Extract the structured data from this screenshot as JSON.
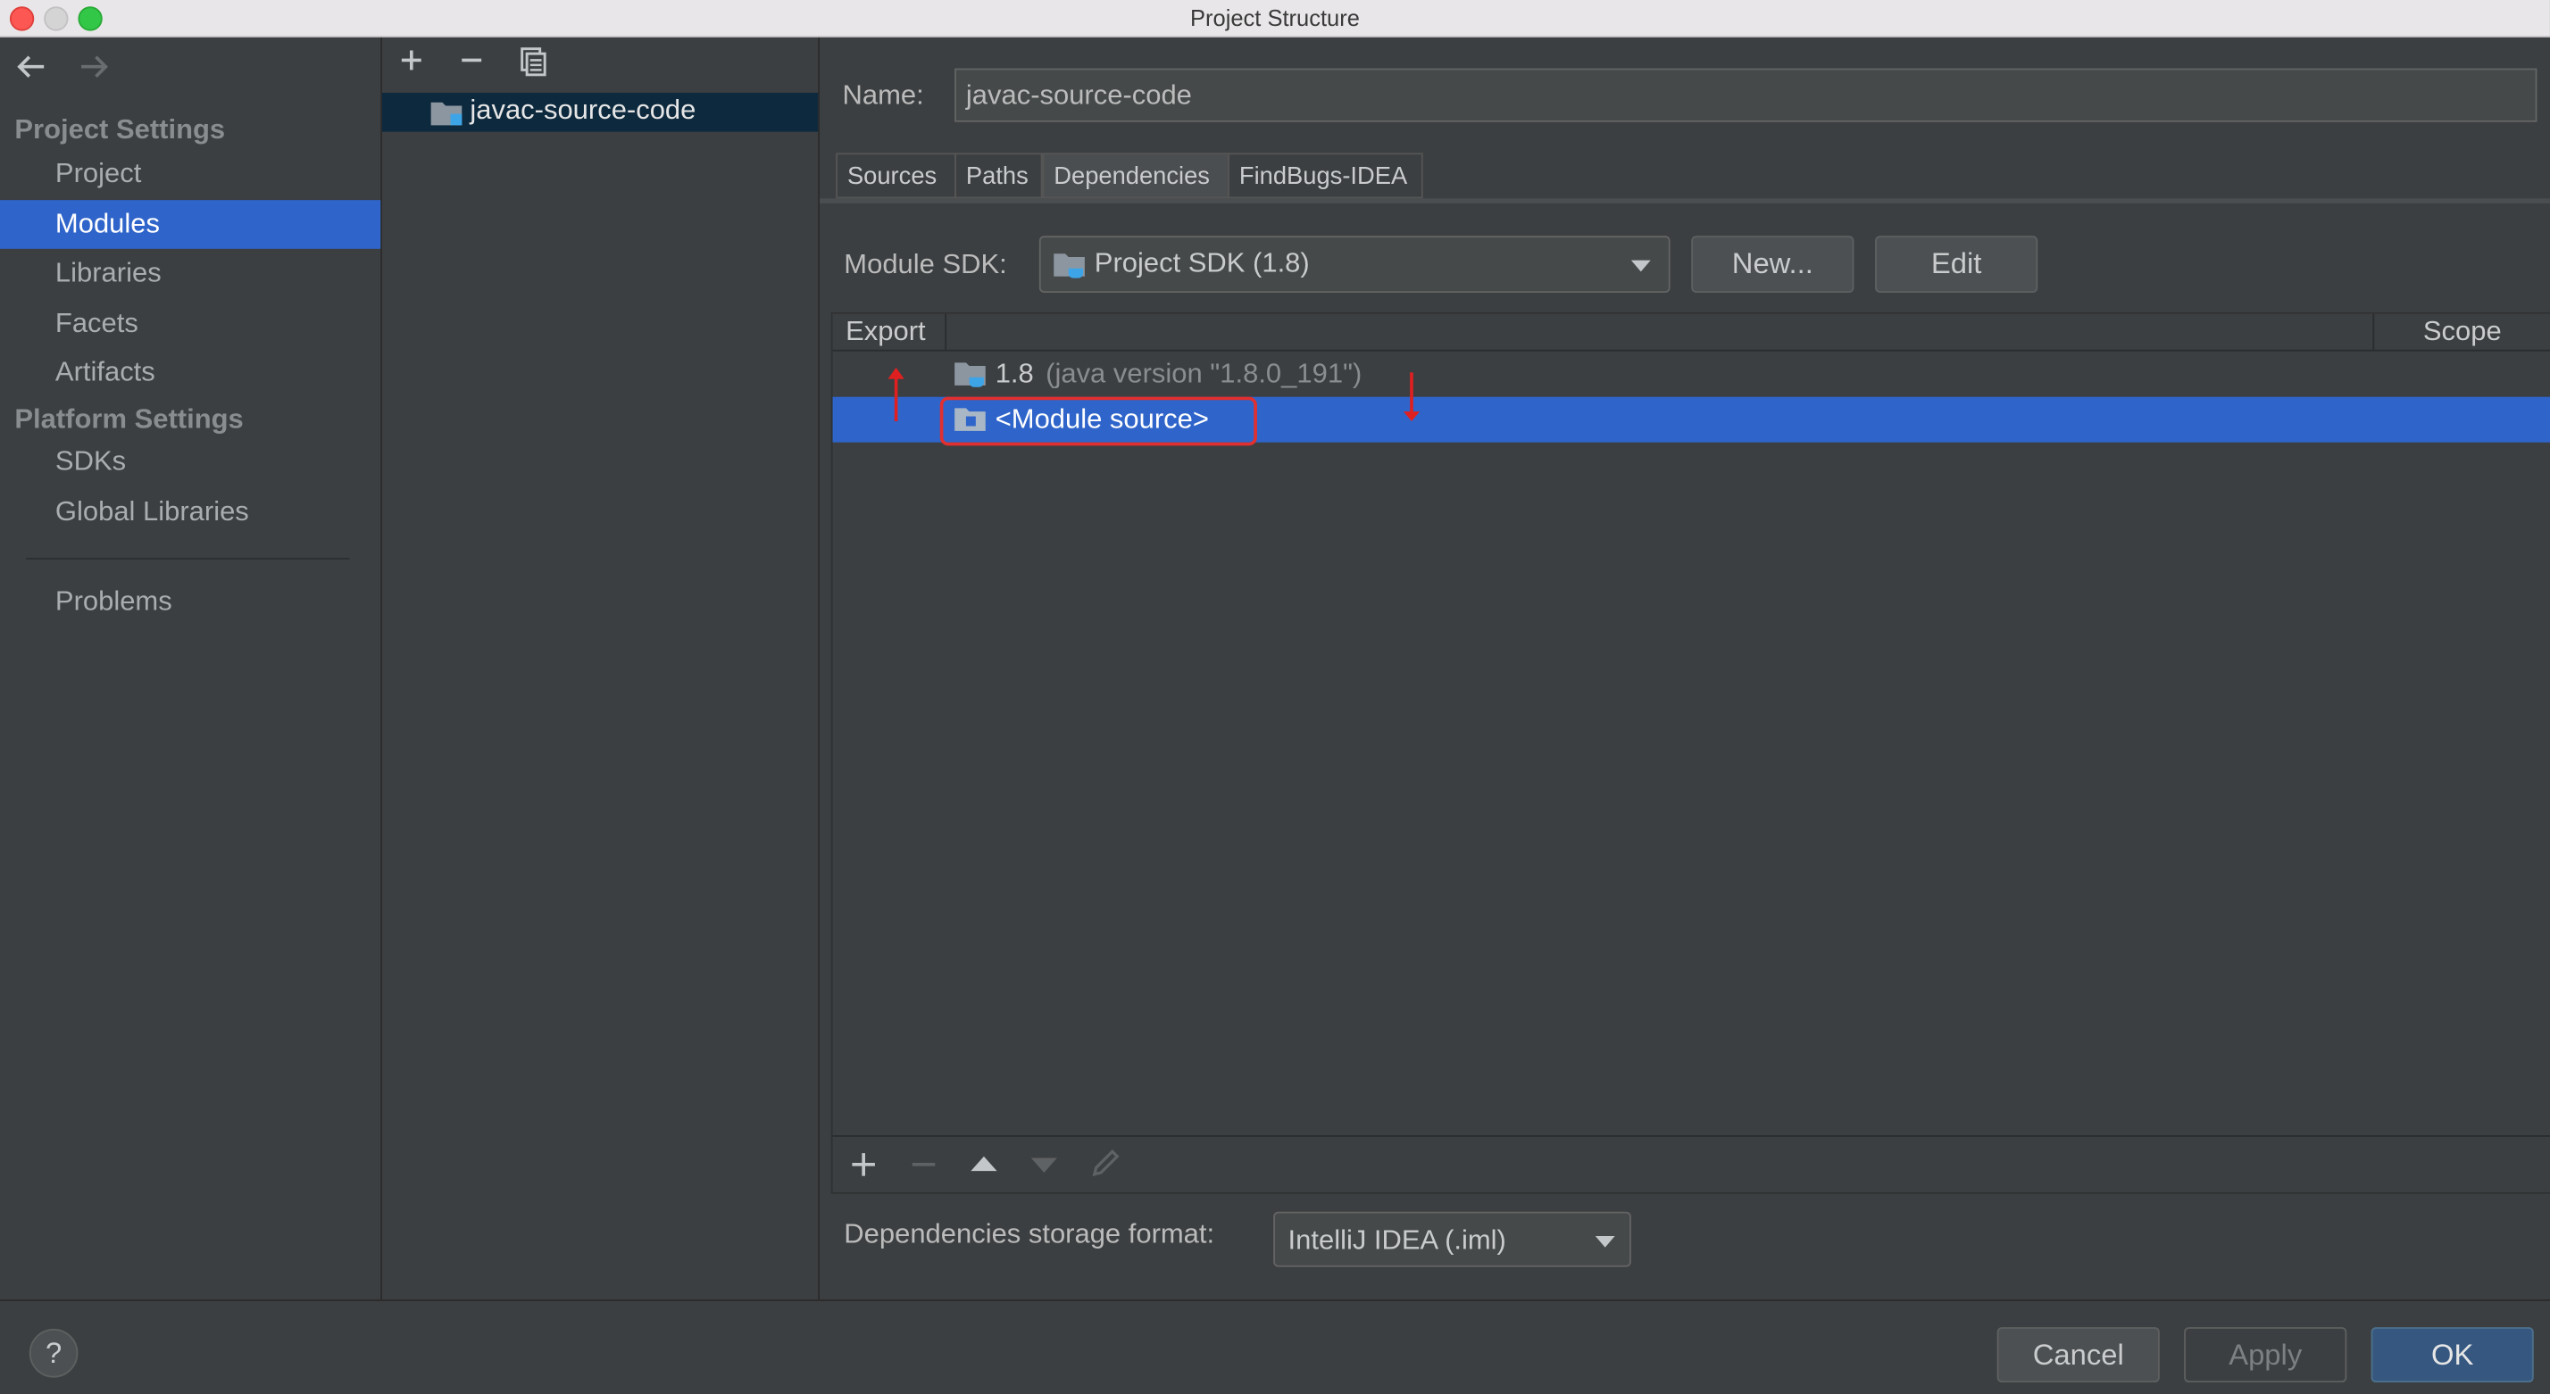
{
  "window": {
    "title": "Project Structure"
  },
  "nav": {
    "back_icon": "arrow-left-icon",
    "forward_icon": "arrow-right-icon",
    "project_settings_header": "Project Settings",
    "platform_settings_header": "Platform Settings",
    "items": [
      {
        "label": "Project"
      },
      {
        "label": "Modules"
      },
      {
        "label": "Libraries"
      },
      {
        "label": "Facets"
      },
      {
        "label": "Artifacts"
      },
      {
        "label": "SDKs"
      },
      {
        "label": "Global Libraries"
      },
      {
        "label": "Problems"
      }
    ],
    "selected": "Modules"
  },
  "modules_tree": {
    "toolbar_icons": [
      "plus-icon",
      "minus-icon",
      "copy-icon"
    ],
    "items": [
      {
        "label": "javac-source-code"
      }
    ]
  },
  "module": {
    "name_label": "Name:",
    "name_value": "javac-source-code",
    "tabs": [
      {
        "label": "Sources"
      },
      {
        "label": "Paths"
      },
      {
        "label": "Dependencies"
      },
      {
        "label": "FindBugs-IDEA"
      }
    ],
    "active_tab": "Dependencies",
    "sdk_label": "Module SDK:",
    "sdk_value": "Project SDK (1.8)",
    "new_button": "New...",
    "edit_button": "Edit",
    "table": {
      "columns": [
        "Export",
        "Scope"
      ],
      "rows": [
        {
          "name": "1.8",
          "detail": "(java version \"1.8.0_191\")"
        },
        {
          "name": "<Module source>",
          "detail": ""
        }
      ]
    },
    "storage_label": "Dependencies storage format:",
    "storage_value": "IntelliJ IDEA (.iml)"
  },
  "footer": {
    "help_label": "?",
    "cancel": "Cancel",
    "apply": "Apply",
    "ok": "OK"
  },
  "colors": {
    "accent": "#2f65ca",
    "annotation_red": "#e22f2f",
    "background": "#3c3f41"
  }
}
